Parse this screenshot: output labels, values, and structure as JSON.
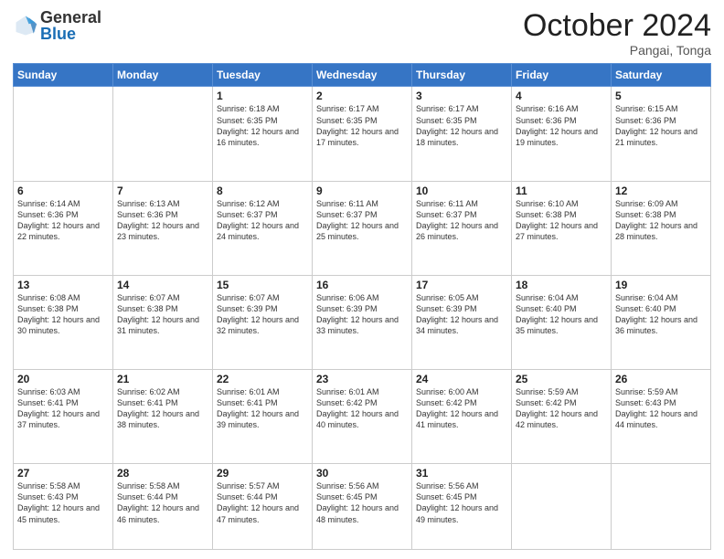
{
  "header": {
    "logo_general": "General",
    "logo_blue": "Blue",
    "month_title": "October 2024",
    "location": "Pangai, Tonga"
  },
  "days_of_week": [
    "Sunday",
    "Monday",
    "Tuesday",
    "Wednesday",
    "Thursday",
    "Friday",
    "Saturday"
  ],
  "weeks": [
    [
      {
        "day": "",
        "info": ""
      },
      {
        "day": "",
        "info": ""
      },
      {
        "day": "1",
        "info": "Sunrise: 6:18 AM\nSunset: 6:35 PM\nDaylight: 12 hours and 16 minutes."
      },
      {
        "day": "2",
        "info": "Sunrise: 6:17 AM\nSunset: 6:35 PM\nDaylight: 12 hours and 17 minutes."
      },
      {
        "day": "3",
        "info": "Sunrise: 6:17 AM\nSunset: 6:35 PM\nDaylight: 12 hours and 18 minutes."
      },
      {
        "day": "4",
        "info": "Sunrise: 6:16 AM\nSunset: 6:36 PM\nDaylight: 12 hours and 19 minutes."
      },
      {
        "day": "5",
        "info": "Sunrise: 6:15 AM\nSunset: 6:36 PM\nDaylight: 12 hours and 21 minutes."
      }
    ],
    [
      {
        "day": "6",
        "info": "Sunrise: 6:14 AM\nSunset: 6:36 PM\nDaylight: 12 hours and 22 minutes."
      },
      {
        "day": "7",
        "info": "Sunrise: 6:13 AM\nSunset: 6:36 PM\nDaylight: 12 hours and 23 minutes."
      },
      {
        "day": "8",
        "info": "Sunrise: 6:12 AM\nSunset: 6:37 PM\nDaylight: 12 hours and 24 minutes."
      },
      {
        "day": "9",
        "info": "Sunrise: 6:11 AM\nSunset: 6:37 PM\nDaylight: 12 hours and 25 minutes."
      },
      {
        "day": "10",
        "info": "Sunrise: 6:11 AM\nSunset: 6:37 PM\nDaylight: 12 hours and 26 minutes."
      },
      {
        "day": "11",
        "info": "Sunrise: 6:10 AM\nSunset: 6:38 PM\nDaylight: 12 hours and 27 minutes."
      },
      {
        "day": "12",
        "info": "Sunrise: 6:09 AM\nSunset: 6:38 PM\nDaylight: 12 hours and 28 minutes."
      }
    ],
    [
      {
        "day": "13",
        "info": "Sunrise: 6:08 AM\nSunset: 6:38 PM\nDaylight: 12 hours and 30 minutes."
      },
      {
        "day": "14",
        "info": "Sunrise: 6:07 AM\nSunset: 6:38 PM\nDaylight: 12 hours and 31 minutes."
      },
      {
        "day": "15",
        "info": "Sunrise: 6:07 AM\nSunset: 6:39 PM\nDaylight: 12 hours and 32 minutes."
      },
      {
        "day": "16",
        "info": "Sunrise: 6:06 AM\nSunset: 6:39 PM\nDaylight: 12 hours and 33 minutes."
      },
      {
        "day": "17",
        "info": "Sunrise: 6:05 AM\nSunset: 6:39 PM\nDaylight: 12 hours and 34 minutes."
      },
      {
        "day": "18",
        "info": "Sunrise: 6:04 AM\nSunset: 6:40 PM\nDaylight: 12 hours and 35 minutes."
      },
      {
        "day": "19",
        "info": "Sunrise: 6:04 AM\nSunset: 6:40 PM\nDaylight: 12 hours and 36 minutes."
      }
    ],
    [
      {
        "day": "20",
        "info": "Sunrise: 6:03 AM\nSunset: 6:41 PM\nDaylight: 12 hours and 37 minutes."
      },
      {
        "day": "21",
        "info": "Sunrise: 6:02 AM\nSunset: 6:41 PM\nDaylight: 12 hours and 38 minutes."
      },
      {
        "day": "22",
        "info": "Sunrise: 6:01 AM\nSunset: 6:41 PM\nDaylight: 12 hours and 39 minutes."
      },
      {
        "day": "23",
        "info": "Sunrise: 6:01 AM\nSunset: 6:42 PM\nDaylight: 12 hours and 40 minutes."
      },
      {
        "day": "24",
        "info": "Sunrise: 6:00 AM\nSunset: 6:42 PM\nDaylight: 12 hours and 41 minutes."
      },
      {
        "day": "25",
        "info": "Sunrise: 5:59 AM\nSunset: 6:42 PM\nDaylight: 12 hours and 42 minutes."
      },
      {
        "day": "26",
        "info": "Sunrise: 5:59 AM\nSunset: 6:43 PM\nDaylight: 12 hours and 44 minutes."
      }
    ],
    [
      {
        "day": "27",
        "info": "Sunrise: 5:58 AM\nSunset: 6:43 PM\nDaylight: 12 hours and 45 minutes."
      },
      {
        "day": "28",
        "info": "Sunrise: 5:58 AM\nSunset: 6:44 PM\nDaylight: 12 hours and 46 minutes."
      },
      {
        "day": "29",
        "info": "Sunrise: 5:57 AM\nSunset: 6:44 PM\nDaylight: 12 hours and 47 minutes."
      },
      {
        "day": "30",
        "info": "Sunrise: 5:56 AM\nSunset: 6:45 PM\nDaylight: 12 hours and 48 minutes."
      },
      {
        "day": "31",
        "info": "Sunrise: 5:56 AM\nSunset: 6:45 PM\nDaylight: 12 hours and 49 minutes."
      },
      {
        "day": "",
        "info": ""
      },
      {
        "day": "",
        "info": ""
      }
    ]
  ]
}
